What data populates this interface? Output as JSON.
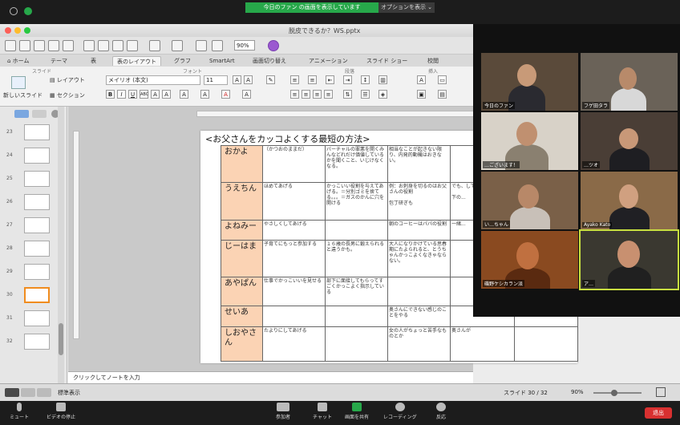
{
  "zoom_top": {
    "share_banner": "今日のファン の画面を表示しています",
    "options": "オプションを表示 ⌄"
  },
  "ppt": {
    "title": "脱皮できるか？WS.pptx",
    "zoom": "90%",
    "tabs": [
      "ホーム",
      "テーマ",
      "表",
      "表のレイアウト",
      "グラフ",
      "SmartArt",
      "画面切り替え",
      "アニメーション",
      "スライド ショー",
      "校閲"
    ],
    "active_tab": "表のレイアウト",
    "groups": {
      "slides": "スライド",
      "font": "フォント",
      "paragraph": "段落",
      "insert": "挿入"
    },
    "new_slide": "新しいスライド",
    "layout": "レイアウト",
    "section": "セクション",
    "font_name": "メイリオ (本文)",
    "font_size": "11",
    "thumb_numbers": [
      "23",
      "24",
      "25",
      "26",
      "27",
      "28",
      "29",
      "30",
      "31",
      "32"
    ],
    "selected_thumb": "30",
    "notes_placeholder": "クリックしてノートを入力",
    "status_view": "標準表示",
    "status_slide": "スライド 30 / 32",
    "status_zoom": "90%"
  },
  "slide": {
    "title": "<お父さんをカッコよくする最短の方法>",
    "rows": [
      {
        "name": "おかよ",
        "c1": "（かつおのままだ）",
        "c2": "バーチャルの罪悪を開くみんなどれだけ価値しているかを聞くこと、いじけなくなる。",
        "c3": "相当なことが起きない限り、内発的動機はおきない。",
        "c4": "",
        "c5": ""
      },
      {
        "name": "うえちん",
        "c1": "ほめてあげる",
        "c2": "かっこいい役割を与えてあげる。＝分別ゴミを捨てる。。。＝ガスのかんに穴を開ける",
        "c3": "例：お刺身を切るのはお父さんの役割\n\n包丁研ぎも",
        "c4": "でも、してくれ...\n\n下の...",
        "c5": ""
      },
      {
        "name": "よねみー",
        "c1": "やさしくしてあげる",
        "c2": "",
        "c3": "朝のコーヒーはパパの役割",
        "c4": "一緒...",
        "c5": ""
      },
      {
        "name": "じーはま",
        "c1": "子育てにもっと参加する",
        "c2": "１６歳の長男に鍛えられると違うかも。",
        "c3": "大人になりかけている思春期にたよられると、とうちゃんかっこよくなきゃならない。",
        "c4": "",
        "c5": ""
      },
      {
        "name": "あやぱん",
        "c1": "仕事でかっこいいを見せる",
        "c2": "部下に面接してもらってすごくかっこよく指示している",
        "c3": "",
        "c4": "",
        "c5": ""
      },
      {
        "name": "せいあ",
        "c1": "",
        "c2": "",
        "c3": "奥さんにできない感じのことをやる",
        "c4": "",
        "c5": ""
      },
      {
        "name": "しおやさん",
        "c1": "たよりにしてあげる",
        "c2": "",
        "c3": "女の人がちょっと苦手なものとか",
        "c4": "奥さんが",
        "c5": ""
      }
    ]
  },
  "participants": [
    {
      "name": "今日のファン"
    },
    {
      "name": "フゲ田タラ"
    },
    {
      "name": "…ございます！"
    },
    {
      "name": "…ツオ"
    },
    {
      "name": "い…ちゃん"
    },
    {
      "name": "Ayako Kato"
    },
    {
      "name": "磯野ケシカラン派"
    },
    {
      "name": "ア…"
    }
  ],
  "zoom_bottom": {
    "mute": "ミュート",
    "video": "ビデオの停止",
    "participants": "参加者",
    "chat": "チャット",
    "share": "画面を共有",
    "record": "レコーディング",
    "reactions": "反応",
    "end": "退出"
  }
}
